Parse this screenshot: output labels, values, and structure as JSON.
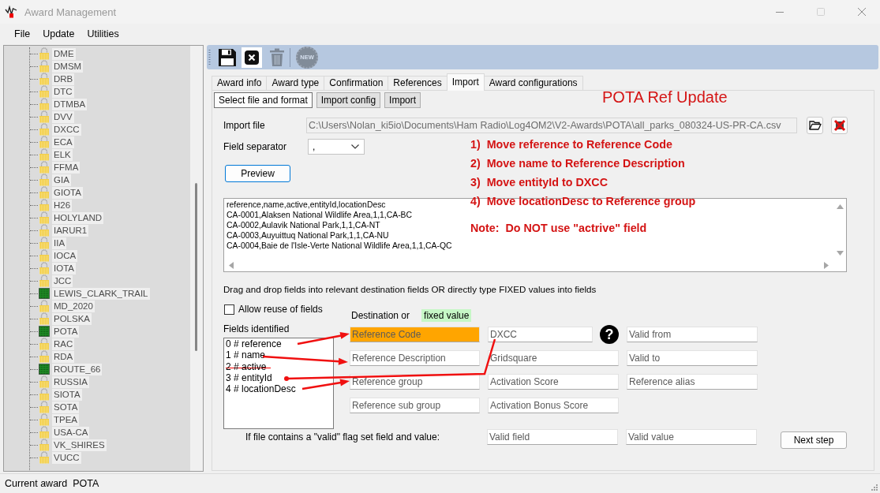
{
  "window": {
    "title": "Award Management"
  },
  "menu": [
    {
      "label": "File"
    },
    {
      "label": "Update"
    },
    {
      "label": "Utilities"
    }
  ],
  "award_tree": {
    "items": [
      {
        "label": "DME",
        "kind": "lock"
      },
      {
        "label": "DMSM",
        "kind": "lock"
      },
      {
        "label": "DRB",
        "kind": "lock"
      },
      {
        "label": "DTC",
        "kind": "lock"
      },
      {
        "label": "DTMBA",
        "kind": "lock"
      },
      {
        "label": "DVV",
        "kind": "lock"
      },
      {
        "label": "DXCC",
        "kind": "lock"
      },
      {
        "label": "ECA",
        "kind": "lock"
      },
      {
        "label": "ELK",
        "kind": "lock"
      },
      {
        "label": "FFMA",
        "kind": "lock"
      },
      {
        "label": "GIA",
        "kind": "lock"
      },
      {
        "label": "GIOTA",
        "kind": "lock"
      },
      {
        "label": "H26",
        "kind": "lock"
      },
      {
        "label": "HOLYLAND",
        "kind": "lock"
      },
      {
        "label": "IARUR1",
        "kind": "lock"
      },
      {
        "label": "IIA",
        "kind": "lock"
      },
      {
        "label": "IOCA",
        "kind": "lock"
      },
      {
        "label": "IOTA",
        "kind": "lock"
      },
      {
        "label": "JCC",
        "kind": "lock"
      },
      {
        "label": "LEWIS_CLARK_TRAIL",
        "kind": "square"
      },
      {
        "label": "MD_2020",
        "kind": "lock"
      },
      {
        "label": "POLSKA",
        "kind": "lock"
      },
      {
        "label": "POTA",
        "kind": "square"
      },
      {
        "label": "RAC",
        "kind": "lock"
      },
      {
        "label": "RDA",
        "kind": "lock"
      },
      {
        "label": "ROUTE_66",
        "kind": "square"
      },
      {
        "label": "RUSSIA",
        "kind": "lock"
      },
      {
        "label": "SIOTA",
        "kind": "lock"
      },
      {
        "label": "SOTA",
        "kind": "lock"
      },
      {
        "label": "TPEA",
        "kind": "lock"
      },
      {
        "label": "USA-CA",
        "kind": "lock"
      },
      {
        "label": "VK_SHIRES",
        "kind": "lock"
      },
      {
        "label": "VUCC",
        "kind": "lock"
      }
    ]
  },
  "toolbar": {
    "buttons": [
      {
        "kind": "save",
        "disabled": false
      },
      {
        "kind": "close",
        "disabled": false
      },
      {
        "kind": "delete",
        "disabled": true
      },
      {
        "kind": "new",
        "label": "NEW",
        "disabled": true
      }
    ]
  },
  "tabs": [
    {
      "label": "Award info",
      "selected": false
    },
    {
      "label": "Award type",
      "selected": false
    },
    {
      "label": "Confirmation",
      "selected": false
    },
    {
      "label": "References",
      "selected": false
    },
    {
      "label": "Import",
      "selected": true
    },
    {
      "label": "Award configurations",
      "selected": false
    }
  ],
  "subtabs": [
    {
      "label": "Select file and format",
      "selected": true
    },
    {
      "label": "Import config",
      "selected": false
    },
    {
      "label": "Import",
      "selected": false
    }
  ],
  "annotations": {
    "title": "POTA Ref Update",
    "steps": [
      "1)  Move reference to Reference Code",
      "2)  Move name to Reference Description",
      "3)  Move entityId to DXCC",
      "4)  Move locationDesc to Reference group"
    ],
    "note": "Note:  Do NOT use \"actrive\" field"
  },
  "import_file": {
    "label": "Import file",
    "value": "C:\\Users\\Nolan_ki5io\\Documents\\Ham Radio\\Log4OM2\\V2-Awards\\POTA\\all_parks_080324-US-PR-CA.csv"
  },
  "field_separator": {
    "label": "Field separator",
    "value": ","
  },
  "preview_button": {
    "label": "Preview"
  },
  "preview": {
    "lines": [
      "reference,name,active,entityId,locationDesc",
      "CA-0001,Alaksen National Wildlife Area,1,1,CA-BC",
      "CA-0002,Aulavik National Park,1,1,CA-NT",
      "CA-0003,Auyuittuq National Park,1,1,CA-NU",
      "CA-0004,Baie de l'Isle-Verte National Wildlife Area,1,1,CA-QC"
    ]
  },
  "instructions": "Drag and drop fields into relevant destination fields OR directly type FIXED values into fields",
  "allow_reuse": {
    "label": "Allow reuse of fields",
    "checked": false
  },
  "fields_identified": {
    "label": "Fields identified",
    "items": [
      {
        "text": "0 # reference",
        "struck": false
      },
      {
        "text": "1 # name",
        "struck": false
      },
      {
        "text": "2 # active",
        "struck": true
      },
      {
        "text": "3 # entityId",
        "struck": false
      },
      {
        "text": "4 # locationDesc",
        "struck": false
      }
    ]
  },
  "destination": {
    "label": "Destination or",
    "fixed_label": "fixed value",
    "columns": [
      [
        {
          "placeholder": "Reference Code",
          "highlighted": true
        },
        {
          "placeholder": "Reference Description",
          "highlighted": false
        },
        {
          "placeholder": "Reference group",
          "highlighted": false
        },
        {
          "placeholder": "Reference sub group",
          "highlighted": false
        }
      ],
      [
        {
          "placeholder": "DXCC",
          "highlighted": false,
          "help_mark": "?"
        },
        {
          "placeholder": "Gridsquare",
          "highlighted": false
        },
        {
          "placeholder": "Activation Score",
          "highlighted": false
        },
        {
          "placeholder": "Activation Bonus Score",
          "highlighted": false
        }
      ],
      [
        {
          "placeholder": "Valid from",
          "highlighted": false
        },
        {
          "placeholder": "Valid to",
          "highlighted": false
        },
        {
          "placeholder": "Reference alias",
          "highlighted": false
        }
      ]
    ]
  },
  "valid_flag": {
    "label": "If file contains a \"valid\" flag set field and value:",
    "fields": [
      {
        "placeholder": "Valid field"
      },
      {
        "placeholder": "Valid value"
      }
    ]
  },
  "next_button": {
    "label": "Next step"
  },
  "status_bar": {
    "label": "Current award",
    "value": "POTA"
  }
}
